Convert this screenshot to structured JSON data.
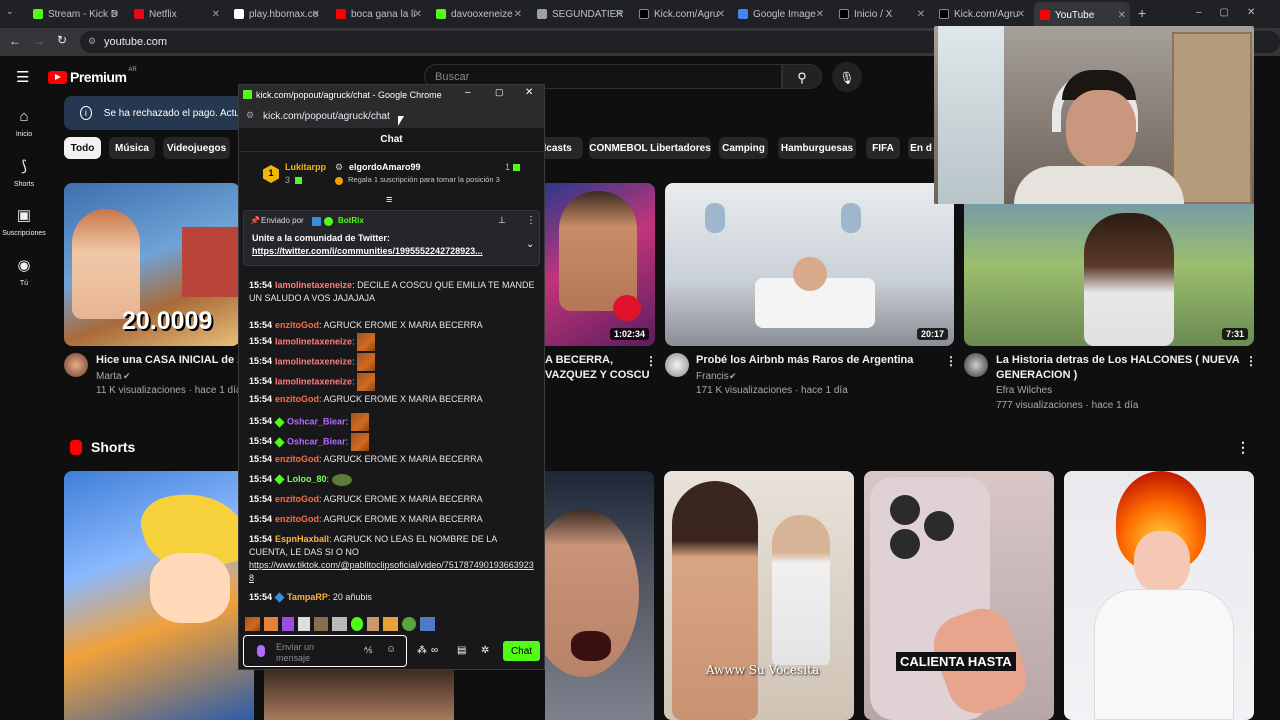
{
  "browser": {
    "tabs": [
      {
        "label": "Stream - Kick D",
        "fav": "#53fc18"
      },
      {
        "label": "Netflix",
        "fav": "#e50914"
      },
      {
        "label": "play.hbomax.co",
        "fav": "#ffffff"
      },
      {
        "label": "boca gana la li",
        "fav": "#ff0000"
      },
      {
        "label": "davooxeneize",
        "fav": "#53fc18"
      },
      {
        "label": "SEGUNDATIER",
        "fav": "#9aa0a6"
      },
      {
        "label": "Kick.com/Agru",
        "fav": "#000000"
      },
      {
        "label": "Google Image",
        "fav": "#4285f4"
      },
      {
        "label": "Inicio / X",
        "fav": "#000000"
      },
      {
        "label": "Kick.com/Agru",
        "fav": "#000000"
      },
      {
        "label": "YouTube",
        "fav": "#ff0000"
      }
    ],
    "address": "youtube.com"
  },
  "youtube": {
    "logo": "Premium",
    "region": "AR",
    "search_placeholder": "Buscar",
    "banner": "Se ha rechazado el pago. Actu",
    "sidebar": [
      {
        "label": "Inicio",
        "icon": "home-icon"
      },
      {
        "label": "Shorts",
        "icon": "shorts-icon"
      },
      {
        "label": "Suscripciones",
        "icon": "subscriptions-icon"
      },
      {
        "label": "Tú",
        "icon": "you-icon"
      }
    ],
    "chips": [
      "Todo",
      "Música",
      "Videojuegos",
      "dcasts",
      "CONMEBOL Libertadores",
      "Camping",
      "Hamburguesas",
      "FIFA",
      "En d"
    ],
    "videos": [
      {
        "title": "Hice una CASA INICIAL de 20.",
        "title2": "",
        "channel": "Marta",
        "meta": "11 K visualizaciones · hace 1 día",
        "duration": "",
        "overlay": "20.0009"
      },
      {
        "title": "A BECERRA,",
        "title2": "VAZQUEZ Y COSCU",
        "channel": "",
        "meta": "",
        "duration": "1:02:34",
        "overlay": ""
      },
      {
        "title": "Probé los Airbnb más Raros de Argentina",
        "title2": "",
        "channel": "Francis",
        "meta": "171 K visualizaciones · hace 1 día",
        "duration": "20:17",
        "overlay": ""
      },
      {
        "title": "La Historia detras de Los HALCONES ( NUEVA",
        "title2": "GENERACION )",
        "channel": "Efra Wilches",
        "meta": "777 visualizaciones · hace 1 día",
        "duration": "7:31",
        "overlay": ""
      }
    ],
    "shorts_heading": "Shorts",
    "shorts": [
      {
        "caption": ""
      },
      {
        "caption": ""
      },
      {
        "caption": ""
      },
      {
        "caption": "Awww Su Vocesita"
      },
      {
        "caption": "CALIENTA HASTA"
      },
      {
        "caption": ""
      }
    ]
  },
  "chat_window": {
    "title": "kick.com/popout/agruck/chat - Google Chrome",
    "url": "kick.com/popout/agruck/chat",
    "header": "Chat",
    "leader_rank": "1",
    "leader_name": "Lukitarpp",
    "leader_count": "3",
    "second_name": "elgordoAmaro99",
    "second_count": "1",
    "second_hint": "Regala 1 suscripción para tomar la posición 3",
    "pinned_by_label": "Enviado por",
    "pinned_by_user": "BotRix",
    "pinned_text": "Unite a la comunidad de Twitter:",
    "pinned_link": "https://twitter.com/i/communities/1995552242728923...",
    "messages": [
      {
        "time": "15:54",
        "user": "lamolinetaxeneize",
        "color": "#ff7b7b",
        "text": "DECILE A COSCU QUE EMILIA TE MANDE UN SALUDO A VOS JAJAJAJA"
      },
      {
        "time": "15:54",
        "user": "enzitoGod",
        "color": "#ff6b3d",
        "text": "AGRUCK EROME X MARIA BECERRA"
      },
      {
        "time": "15:54",
        "user": "lamolinetaxeneize",
        "color": "#ff7b7b",
        "text": ""
      },
      {
        "time": "15:54",
        "user": "lamolinetaxeneize",
        "color": "#ff7b7b",
        "text": ""
      },
      {
        "time": "15:54",
        "user": "lamolinetaxeneize",
        "color": "#ff7b7b",
        "text": ""
      },
      {
        "time": "15:54",
        "user": "enzitoGod",
        "color": "#ff6b3d",
        "text": "AGRUCK EROME X MARIA BECERRA"
      },
      {
        "time": "15:54",
        "user": "Oshcar_Biear",
        "color": "#b06cff",
        "text": ""
      },
      {
        "time": "15:54",
        "user": "Oshcar_Biear",
        "color": "#b06cff",
        "text": ""
      },
      {
        "time": "15:54",
        "user": "enzitoGod",
        "color": "#ff6b3d",
        "text": "AGRUCK EROME X MARIA BECERRA"
      },
      {
        "time": "15:54",
        "user": "Loloo_80",
        "color": "#7dff5a",
        "text": ""
      },
      {
        "time": "15:54",
        "user": "enzitoGod",
        "color": "#ff6b3d",
        "text": "AGRUCK EROME X MARIA BECERRA"
      },
      {
        "time": "15:54",
        "user": "enzitoGod",
        "color": "#ff6b3d",
        "text": "AGRUCK EROME X MARIA BECERRA"
      },
      {
        "time": "15:54",
        "user": "EspnHaxball",
        "color": "#ffb13d",
        "text": "AGRUCK NO LEAS EL NOMBRE DE LA CUENTA, LE DAS SI O NO"
      },
      {
        "time": "15:54",
        "user": "TampaRP",
        "color": "#ffb13d",
        "text": "20 añubis"
      }
    ],
    "tiktok_link": "https://www.tiktok.com/@pablitoclipsoficial/video/7517874901936639238",
    "input_placeholder": "Enviar un mensaje",
    "send_label": "Chat"
  }
}
